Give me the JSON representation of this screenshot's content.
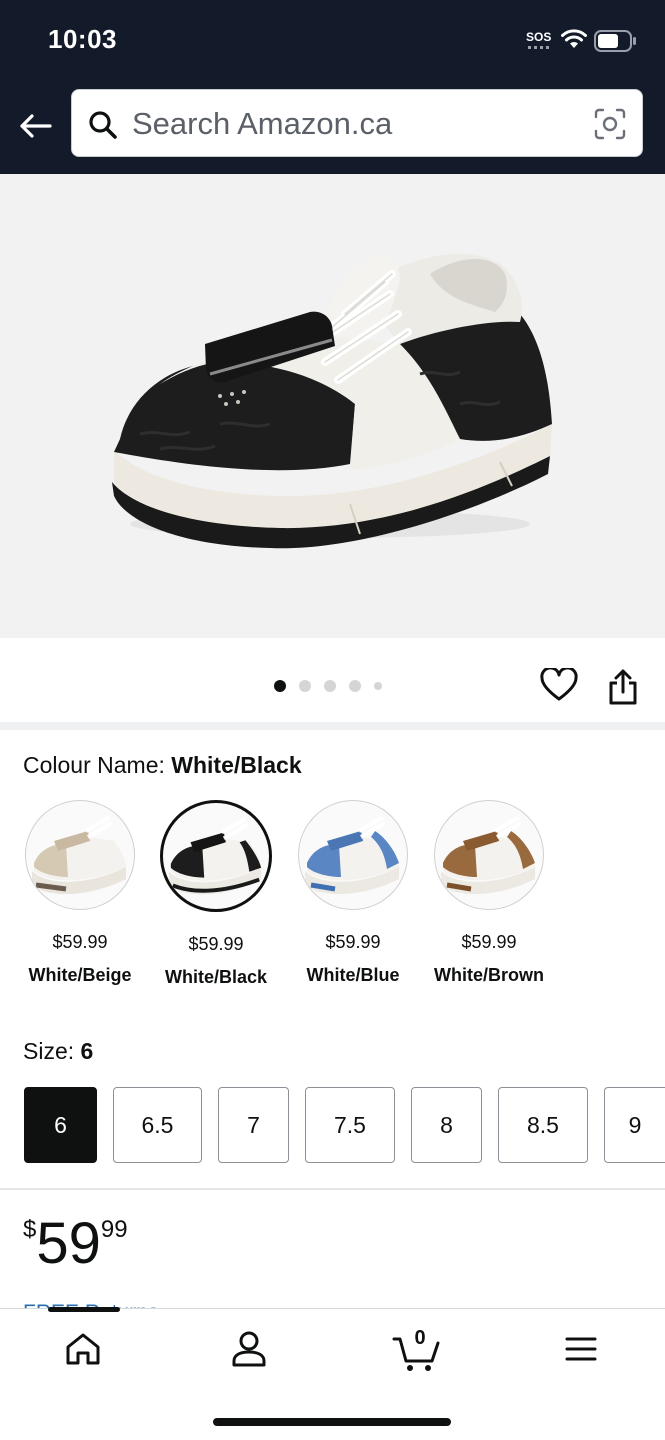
{
  "status_bar": {
    "time": "10:03",
    "sos": "SOS"
  },
  "search": {
    "placeholder": "Search Amazon.ca"
  },
  "gallery": {
    "dot_count": 5,
    "active_index": 0
  },
  "colour": {
    "label": "Colour Name:",
    "selected": "White/Black",
    "options": [
      {
        "price": "$59.99",
        "name": "White/Beige",
        "accent": "#c9b9a3"
      },
      {
        "price": "$59.99",
        "name": "White/Black",
        "accent": "#1a1a1a"
      },
      {
        "price": "$59.99",
        "name": "White/Blue",
        "accent": "#5a86c4"
      },
      {
        "price": "$59.99",
        "name": "White/Brown",
        "accent": "#9a6a3f"
      }
    ]
  },
  "size": {
    "label": "Size:",
    "selected": "6",
    "options": [
      "6",
      "6.5",
      "7",
      "7.5",
      "8",
      "8.5",
      "9"
    ]
  },
  "price": {
    "currency": "$",
    "whole": "59",
    "fraction": "99"
  },
  "free_returns": "FREE Returns",
  "cart": {
    "count": "0"
  },
  "colors": {
    "header_bg": "#131a2a",
    "link": "#2a6fb0"
  }
}
